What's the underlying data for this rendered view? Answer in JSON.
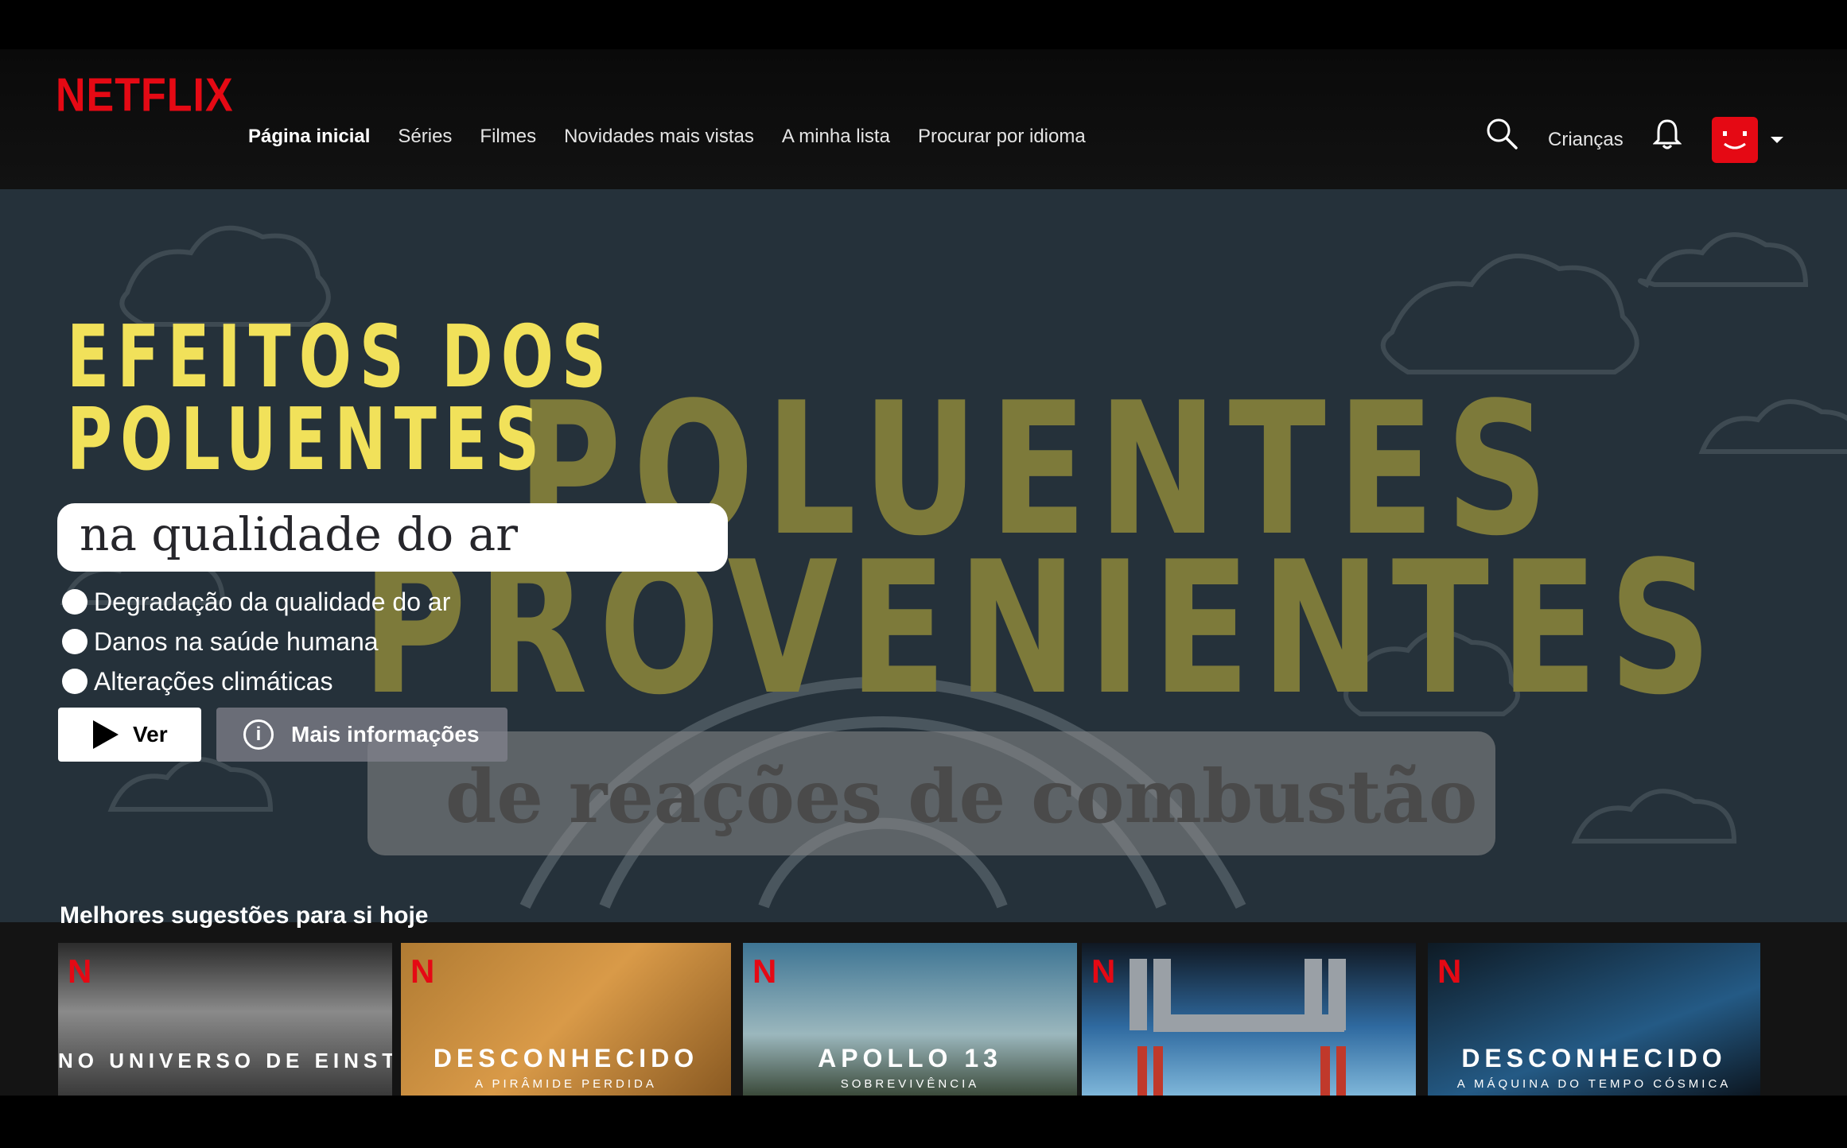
{
  "nav": {
    "logo": "NETFLIX",
    "links": [
      "Página inicial",
      "Séries",
      "Filmes",
      "Novidades mais vistas",
      "A minha lista",
      "Procurar por idioma"
    ],
    "kids": "Crianças"
  },
  "hero": {
    "title_line1": "EFEITOS DOS",
    "title_line2": "POLUENTES",
    "subtitle": "na qualidade do ar",
    "bullets": [
      "Degradação da qualidade do ar",
      "Danos na saúde humana",
      "Alterações climáticas"
    ],
    "bg_word1": "POLUENTES",
    "bg_word2": "PROVENIENTES",
    "bg_combustion": "de reações de combustão",
    "play_label": "Ver",
    "info_label": "Mais informações"
  },
  "row": {
    "title": "Melhores sugestões para si hoje",
    "tiles": [
      {
        "title": "NO UNIVERSO DE EINSTEIN",
        "subtitle": ""
      },
      {
        "title": "DESCONHECIDO",
        "subtitle": "A PIRÂMIDE PERDIDA"
      },
      {
        "title": "APOLLO 13",
        "subtitle": "SOBREVIVÊNCIA"
      },
      {
        "title": "",
        "subtitle": ""
      },
      {
        "title": "DESCONHECIDO",
        "subtitle": "A MÁQUINA DO TEMPO CÓSMICA"
      }
    ]
  },
  "colors": {
    "brand": "#e50914",
    "title_yellow": "#f1e15a",
    "hero_bg": "#25313a"
  }
}
